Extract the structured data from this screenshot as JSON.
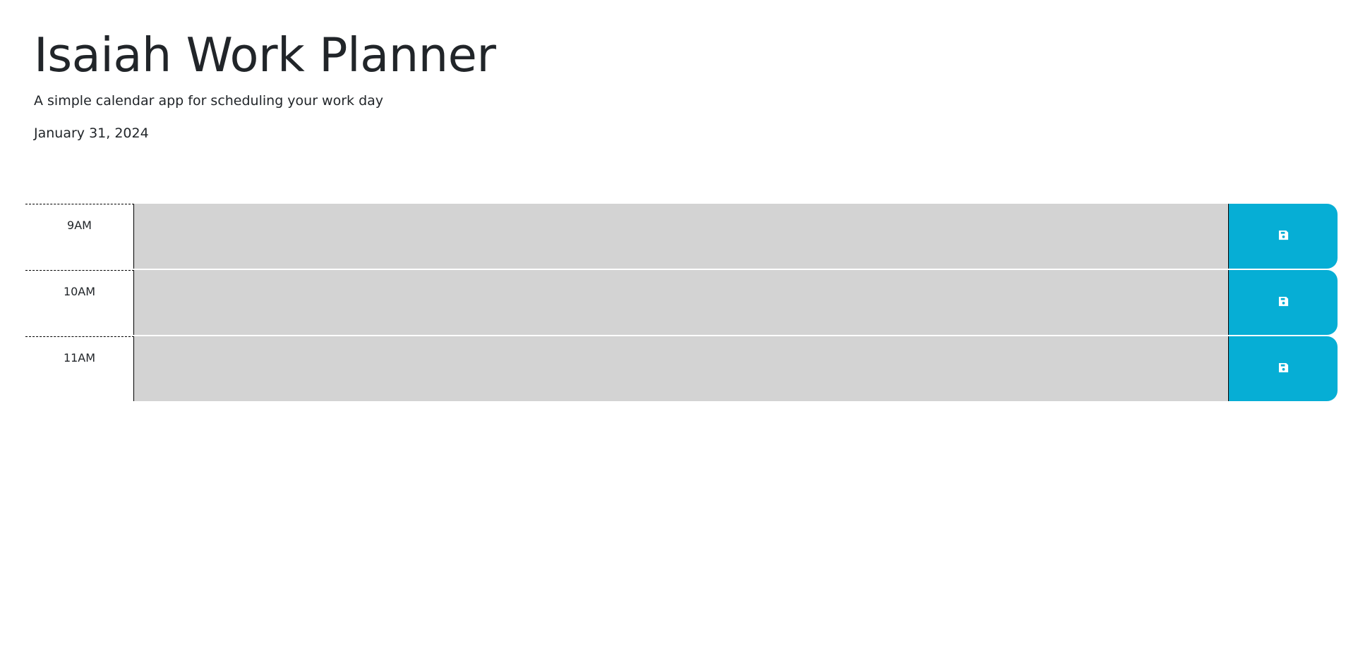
{
  "header": {
    "title": "Isaiah Work Planner",
    "subtitle": "A simple calendar app for scheduling your work day",
    "current_date": "January 31, 2024"
  },
  "planner": {
    "rows": [
      {
        "hour": "9AM",
        "description": "",
        "save_icon": "floppy-disk-icon"
      },
      {
        "hour": "10AM",
        "description": "",
        "save_icon": "floppy-disk-icon"
      },
      {
        "hour": "11AM",
        "description": "",
        "save_icon": "floppy-disk-icon"
      }
    ]
  },
  "colors": {
    "past_block": "#d3d3d3",
    "save_button": "#06aed5"
  }
}
